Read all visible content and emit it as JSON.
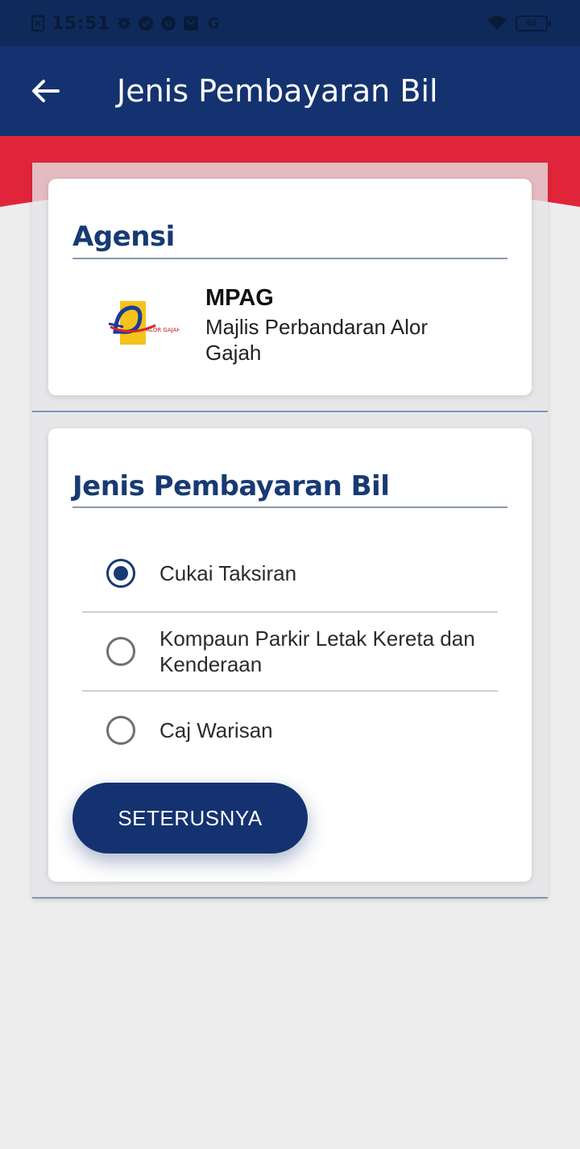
{
  "status_bar": {
    "time": "15:51",
    "battery": "65",
    "left_icons": [
      "screenshot-icon",
      "settings-icon",
      "location-icon",
      "unknown-app-icon",
      "mail-icon",
      "google-icon"
    ],
    "right_icons": [
      "wifi-icon",
      "battery-icon"
    ]
  },
  "app_bar": {
    "title": "Jenis Pembayaran Bil",
    "back_icon": "arrow-left-icon"
  },
  "agency_section": {
    "heading": "Agensi",
    "code": "MPAG",
    "name": "Majlis Perbandaran Alor Gajah",
    "logo_text": "ALOR GAJAH"
  },
  "payment_section": {
    "heading": "Jenis Pembayaran Bil",
    "options": [
      {
        "label": "Cukai Taksiran",
        "selected": true
      },
      {
        "label": "Kompaun Parkir Letak Kereta dan Kenderaan",
        "selected": false
      },
      {
        "label": "Caj Warisan",
        "selected": false
      }
    ],
    "next_label": "SETERUSNYA"
  },
  "colors": {
    "primary": "#14326f",
    "accent_red": "#e0253a",
    "heading": "#173a74"
  }
}
